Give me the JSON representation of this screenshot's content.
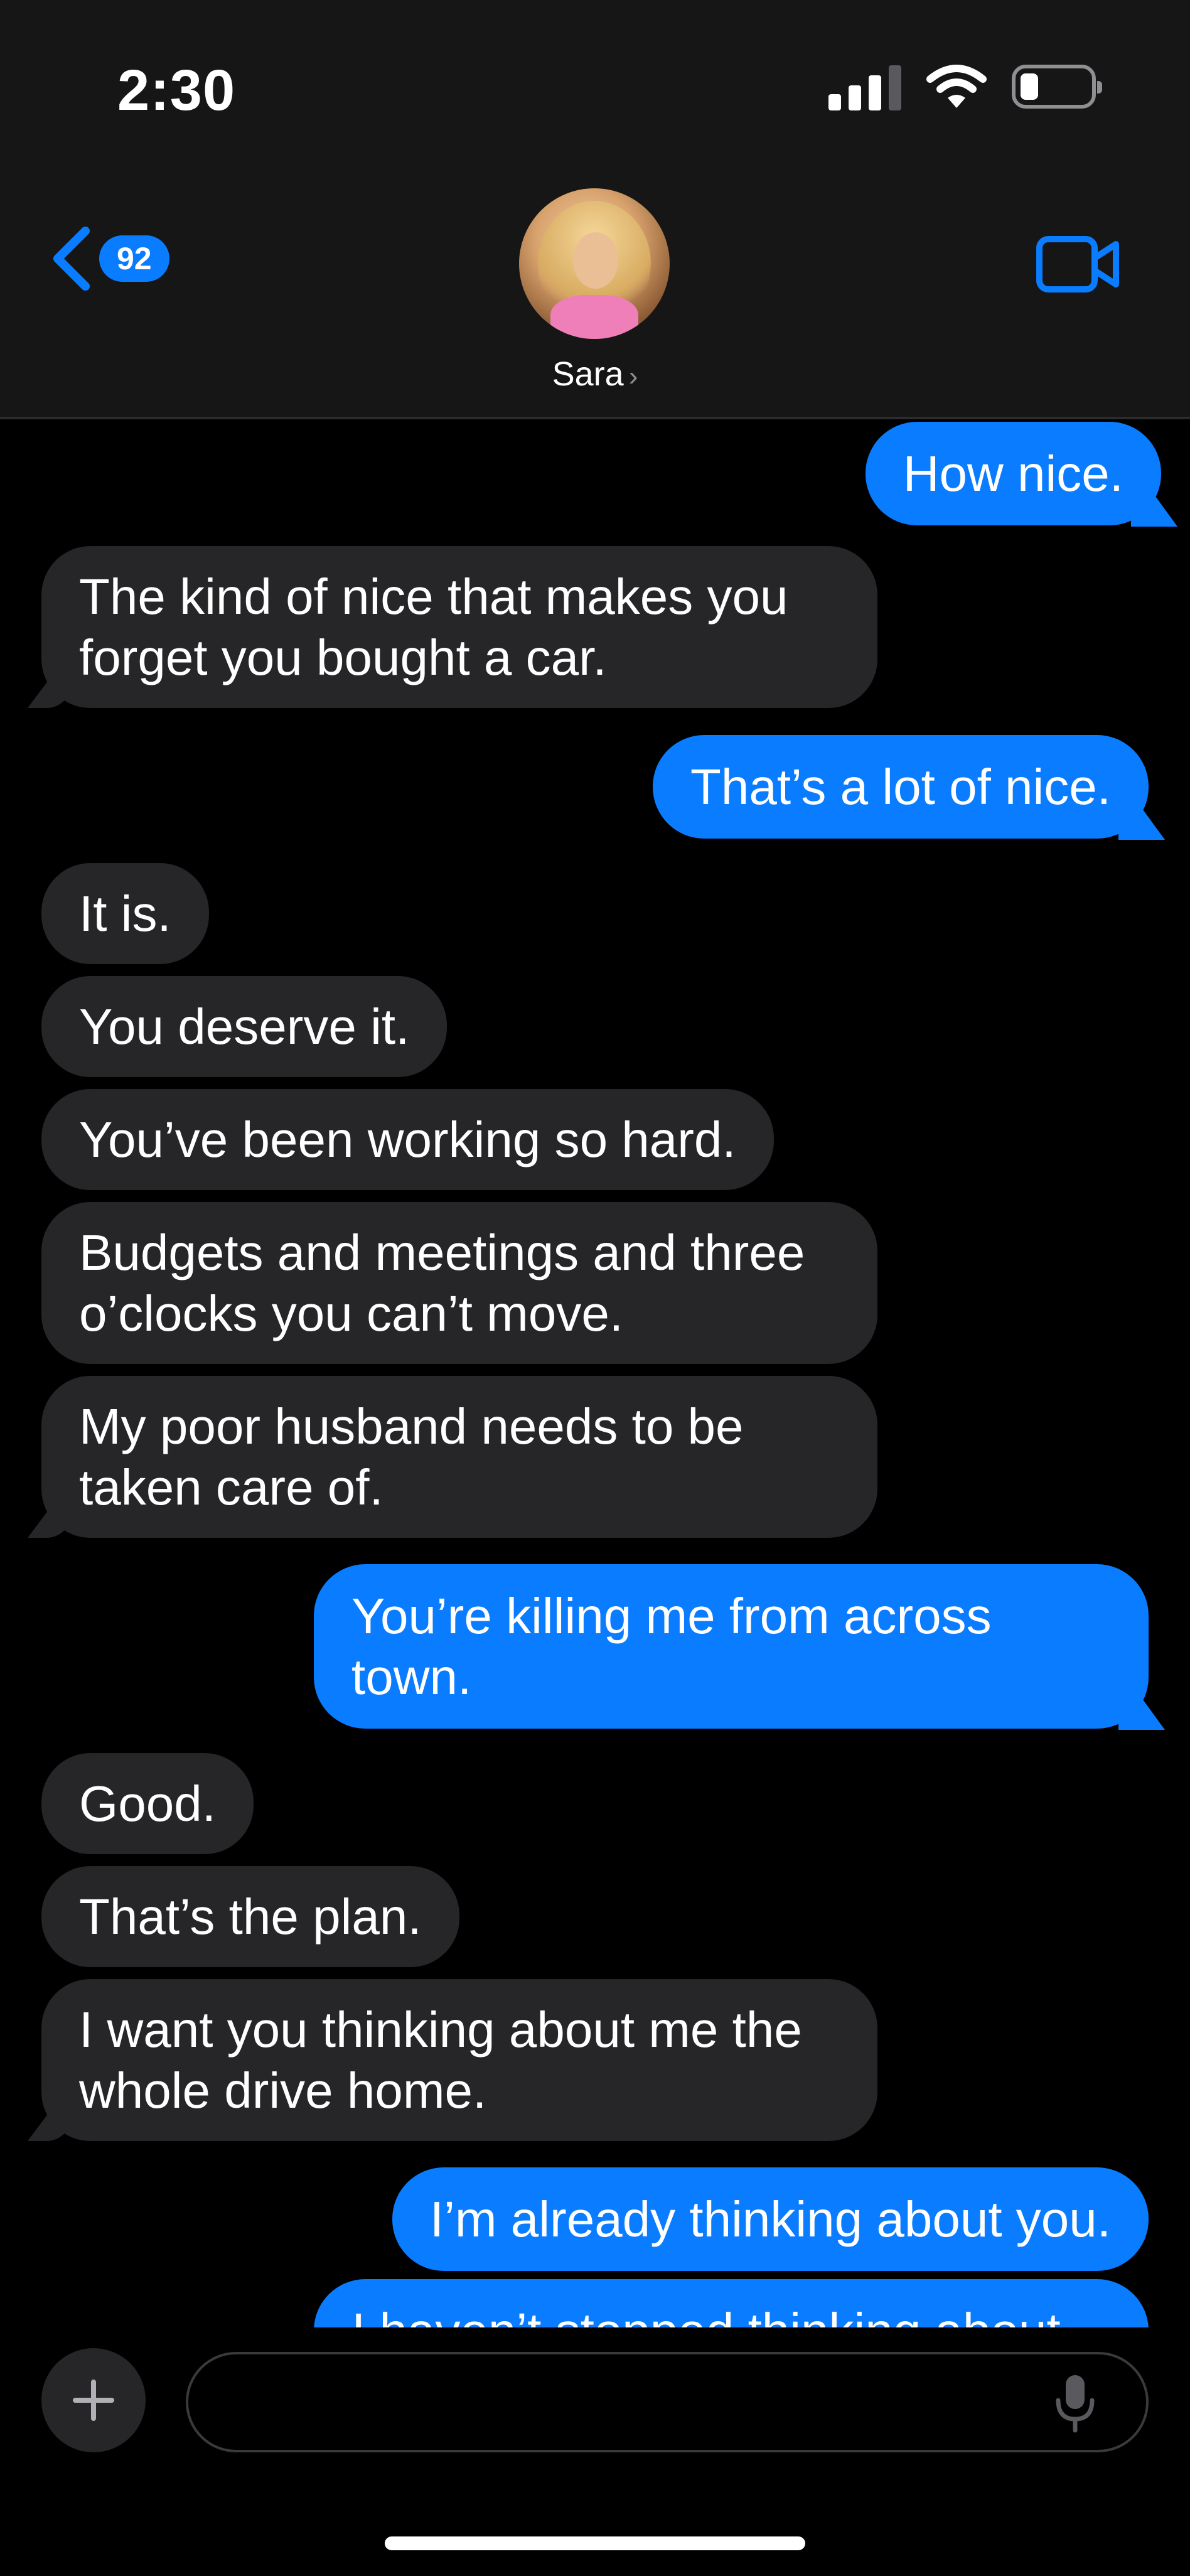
{
  "status_bar": {
    "time": "2:30"
  },
  "header": {
    "back_badge": "92",
    "contact_name": "Sara"
  },
  "messages": [
    {
      "side": "out",
      "text": "How nice."
    },
    {
      "side": "in",
      "text": "The kind of nice that makes you forget you bought a car."
    },
    {
      "side": "out",
      "text": "That’s a lot of nice."
    },
    {
      "side": "in",
      "text": "It is."
    },
    {
      "side": "in",
      "text": "You deserve it."
    },
    {
      "side": "in",
      "text": "You’ve been working so hard."
    },
    {
      "side": "in",
      "text": "Budgets and meetings and three o’clocks you can’t move."
    },
    {
      "side": "in",
      "text": "My poor husband needs to be taken care of."
    },
    {
      "side": "out",
      "text": "You’re killing me from across town."
    },
    {
      "side": "in",
      "text": "Good."
    },
    {
      "side": "in",
      "text": "That’s the plan."
    },
    {
      "side": "in",
      "text": "I want you thinking about me the whole drive home."
    },
    {
      "side": "out",
      "text": "I’m already thinking about you."
    },
    {
      "side": "out",
      "text": "I haven’t stopped thinking about"
    }
  ],
  "composer": {
    "placeholder": ""
  },
  "colors": {
    "accent": "#0a7cff",
    "incoming_bubble": "#262628",
    "header_bg": "#161616"
  },
  "icons": [
    "chevron-left-icon",
    "video-camera-icon",
    "plus-icon",
    "microphone-icon",
    "signal-icon",
    "wifi-icon",
    "battery-icon"
  ]
}
